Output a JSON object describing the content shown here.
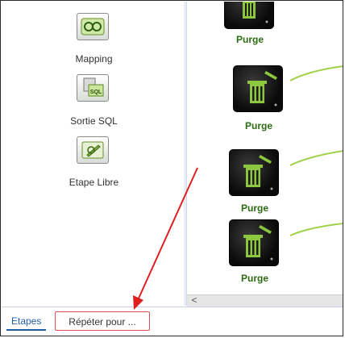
{
  "palette": {
    "items": [
      {
        "label": "Mapping",
        "icon": "mapping-icon"
      },
      {
        "label": "Sortie SQL",
        "icon": "sql-output-icon"
      },
      {
        "label": "Etape Libre",
        "icon": "free-step-icon"
      }
    ]
  },
  "canvas": {
    "nodes": [
      {
        "label": "Purge",
        "icon": "trash-icon"
      },
      {
        "label": "Purge",
        "icon": "trash-icon"
      },
      {
        "label": "Purge",
        "icon": "trash-icon"
      },
      {
        "label": "Purge",
        "icon": "trash-icon"
      }
    ],
    "scroll_left_glyph": "<"
  },
  "tabs": {
    "etapes": "Etapes",
    "repeter": "Répéter pour ..."
  },
  "colors": {
    "accent_green": "#8dc63f",
    "label_green": "#2c6b12",
    "annotation_red": "#e02020",
    "tab_blue": "#1f5fa8"
  }
}
